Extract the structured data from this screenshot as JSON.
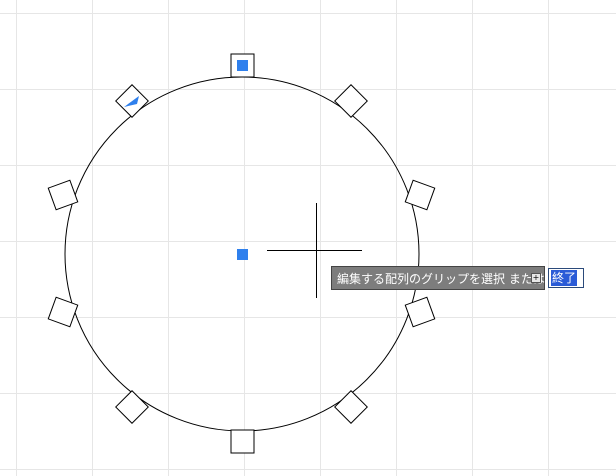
{
  "colors": {
    "background": "#ffffff",
    "grid": "#e6e6e6",
    "geometry": "#000000",
    "grip": "#2f80ed",
    "prompt_bg": "#7d7d7d",
    "option_bg": "#2a5bd7"
  },
  "prompt": {
    "text": "編集する配列のグリップを選択 または",
    "dropdown_icon": "plus-dropdown-icon"
  },
  "option": {
    "label": "終了"
  }
}
